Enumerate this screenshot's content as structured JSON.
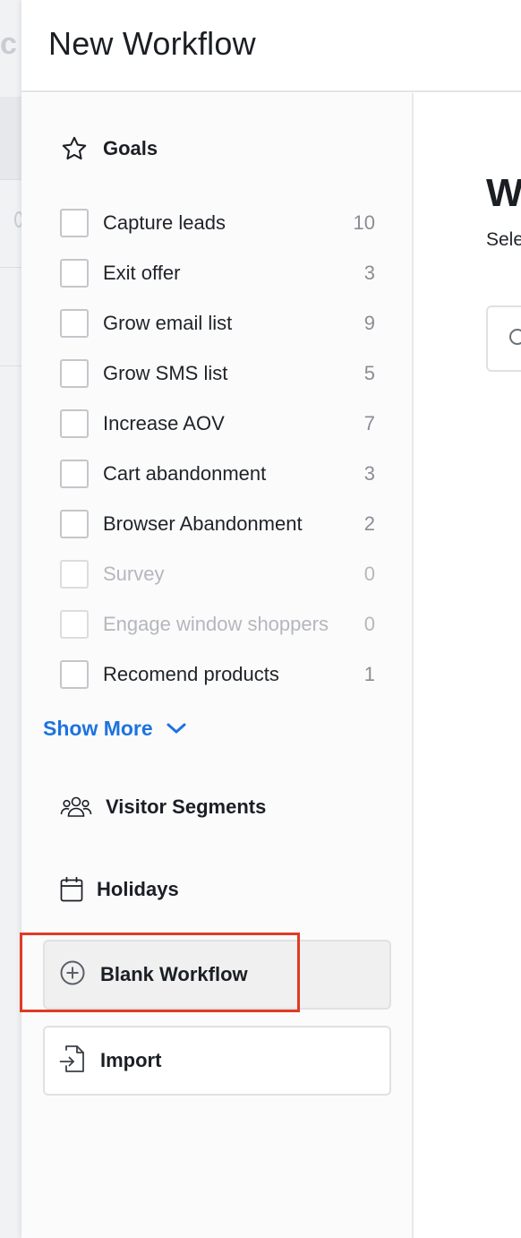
{
  "background": {
    "letter": "c"
  },
  "modal": {
    "title": "New Workflow"
  },
  "sidebar": {
    "goals_header": {
      "label": "Goals",
      "icon": "star-icon"
    },
    "goals": [
      {
        "label": "Capture leads",
        "count": "10",
        "enabled": true
      },
      {
        "label": "Exit offer",
        "count": "3",
        "enabled": true
      },
      {
        "label": "Grow email list",
        "count": "9",
        "enabled": true
      },
      {
        "label": "Grow SMS list",
        "count": "5",
        "enabled": true
      },
      {
        "label": "Increase AOV",
        "count": "7",
        "enabled": true
      },
      {
        "label": "Cart abandonment",
        "count": "3",
        "enabled": true
      },
      {
        "label": "Browser Abandonment",
        "count": "2",
        "enabled": true
      },
      {
        "label": "Survey",
        "count": "0",
        "enabled": false
      },
      {
        "label": "Engage window shoppers",
        "count": "0",
        "enabled": false
      },
      {
        "label": "Recomend products",
        "count": "1",
        "enabled": true
      }
    ],
    "show_more": {
      "label": "Show More",
      "icon": "chevron-down-icon"
    },
    "visitor_segments": {
      "label": "Visitor Segments",
      "icon": "users-icon"
    },
    "holidays": {
      "label": "Holidays",
      "icon": "calendar-icon"
    },
    "blank_workflow": {
      "label": "Blank Workflow",
      "icon": "plus-circle-icon"
    },
    "import": {
      "label": "Import",
      "icon": "import-icon"
    }
  },
  "main": {
    "title": "W",
    "subtitle": "Sele",
    "search_icon": "search-icon"
  },
  "colors": {
    "accent_blue": "#1d73e0",
    "highlight_red": "#e03b24",
    "text_dark": "#1b1f24",
    "muted": "#8a8e94"
  }
}
